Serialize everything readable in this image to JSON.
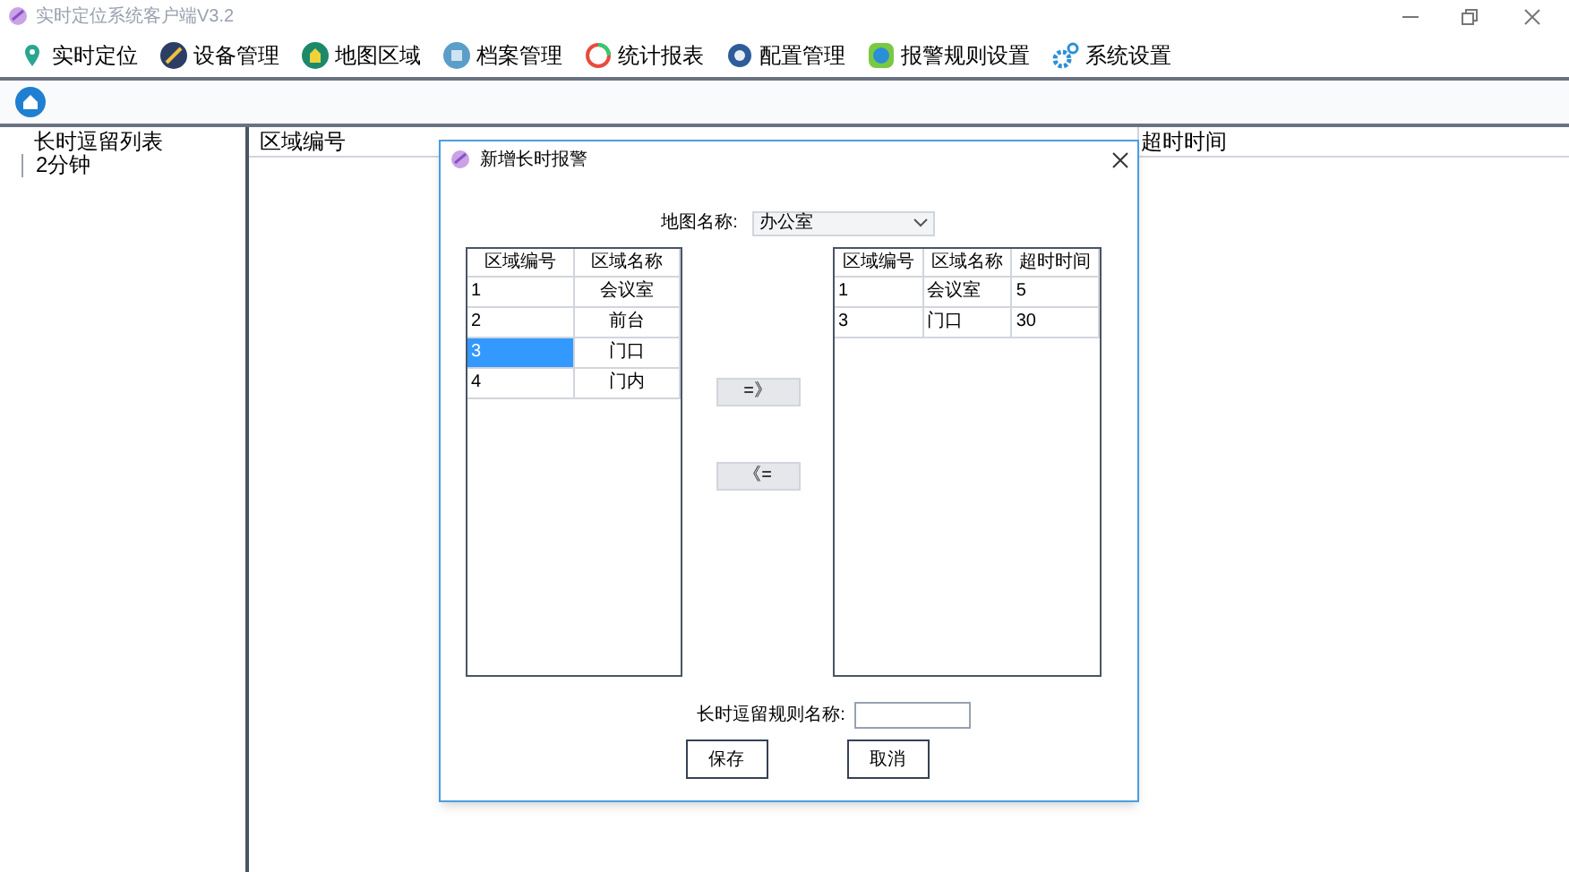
{
  "window": {
    "title": "实时定位系统客户端V3.2"
  },
  "menu": [
    {
      "label": "实时定位"
    },
    {
      "label": "设备管理"
    },
    {
      "label": "地图区域"
    },
    {
      "label": "档案管理"
    },
    {
      "label": "统计报表"
    },
    {
      "label": "配置管理"
    },
    {
      "label": "报警规则设置"
    },
    {
      "label": "系统设置"
    }
  ],
  "tree": [
    {
      "label": "长时逗留列表",
      "children": [
        {
          "label": "2分钟"
        }
      ]
    }
  ],
  "table": {
    "columns": [
      "区域编号",
      "超时时间"
    ]
  },
  "dialog": {
    "title": "新增长时报警",
    "map_label": "地图名称:",
    "map_value": "办公室",
    "left_table": {
      "columns": [
        "区域编号",
        "区域名称"
      ],
      "rows": [
        {
          "cells": [
            "1",
            "会议室"
          ],
          "selected": false
        },
        {
          "cells": [
            "2",
            "前台"
          ],
          "selected": false
        },
        {
          "cells": [
            "3",
            "门口"
          ],
          "selected": true
        },
        {
          "cells": [
            "4",
            "门内"
          ],
          "selected": false
        }
      ]
    },
    "add_button": "=》",
    "remove_button": "《=",
    "right_table": {
      "columns": [
        "区域编号",
        "区域名称",
        "超时时间"
      ],
      "rows": [
        {
          "cells": [
            "1",
            "会议室",
            "5"
          ]
        },
        {
          "cells": [
            "3",
            "门口",
            "30"
          ]
        }
      ]
    },
    "rule_label": "长时逗留规则名称:",
    "buttons": [
      "保存",
      "取消"
    ]
  }
}
